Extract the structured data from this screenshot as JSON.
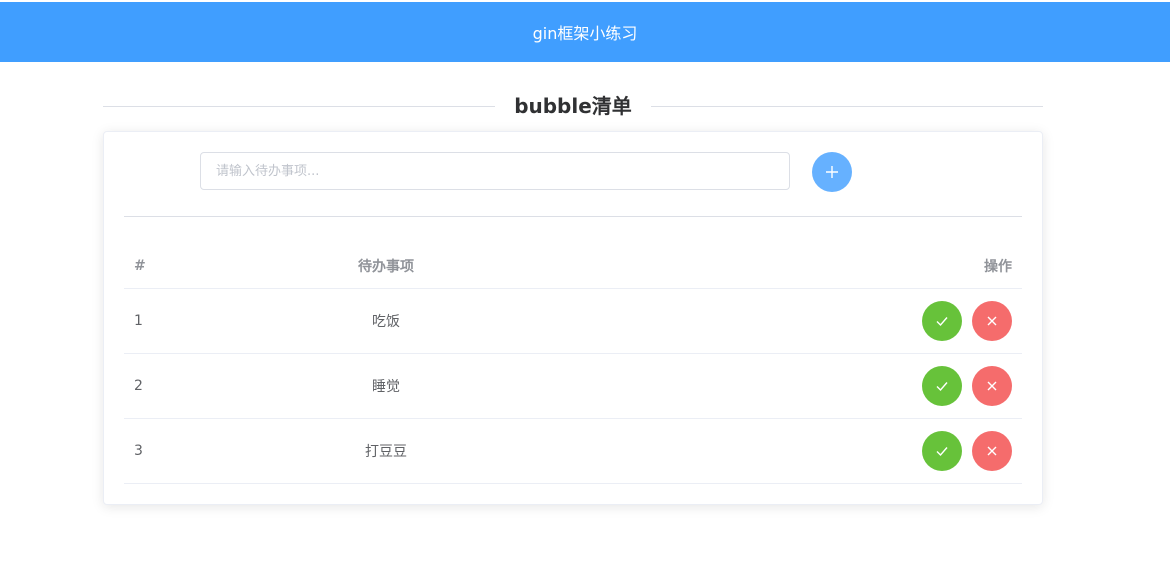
{
  "header": {
    "title": "gin框架小练习"
  },
  "page": {
    "title": "bubble清单"
  },
  "todo_input": {
    "placeholder": "请输入待办事项..."
  },
  "table": {
    "columns": {
      "index": "#",
      "title": "待办事项",
      "actions": "操作"
    },
    "rows": [
      {
        "index": "1",
        "title": "吃饭"
      },
      {
        "index": "2",
        "title": "睡觉"
      },
      {
        "index": "3",
        "title": "打豆豆"
      }
    ]
  },
  "colors": {
    "primary": "#409eff",
    "add_button": "#66b1ff",
    "success": "#67c23a",
    "danger": "#f56c6c"
  },
  "icons": {
    "add": "plus-icon",
    "complete": "check-icon",
    "delete": "close-icon"
  }
}
